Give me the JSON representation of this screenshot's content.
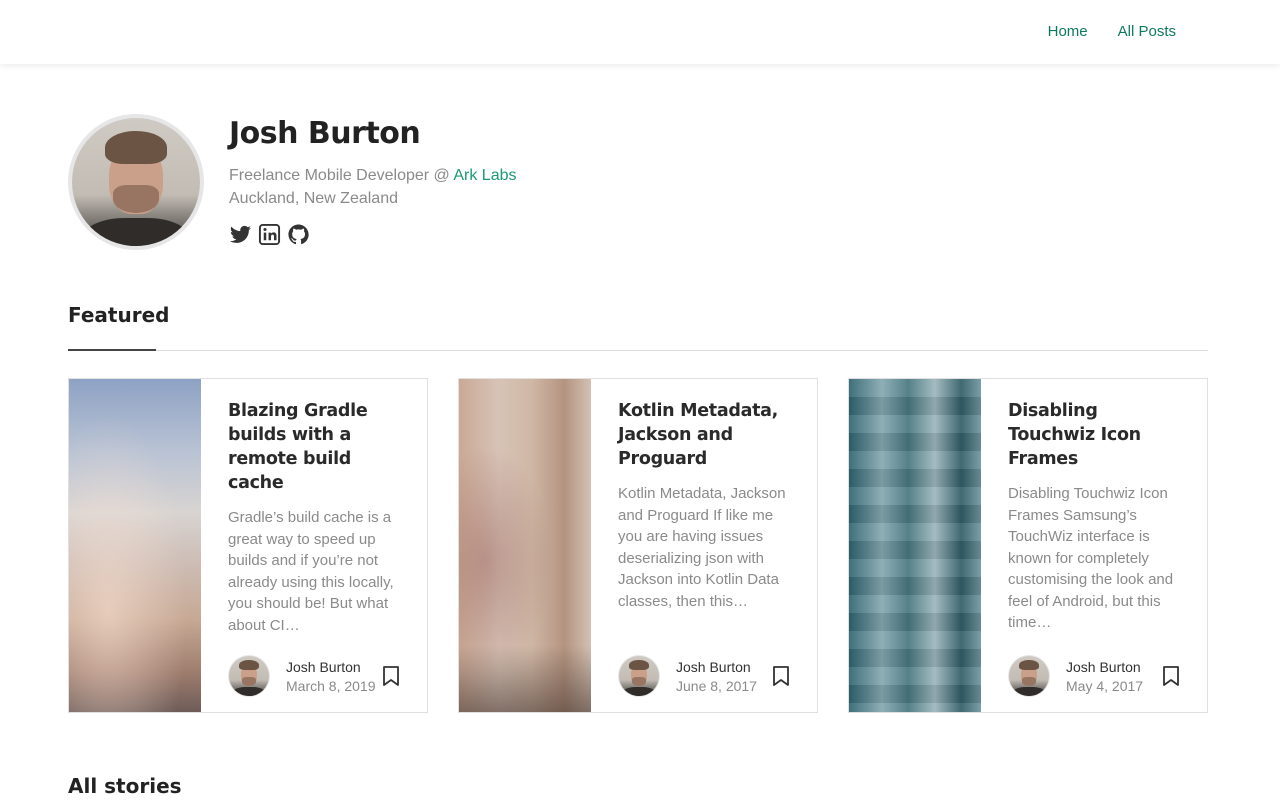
{
  "nav": {
    "items": [
      "Home",
      "All Posts"
    ]
  },
  "profile": {
    "name": "Josh Burton",
    "bio_prefix": "Freelance Mobile Developer @ ",
    "company": "Ark Labs",
    "location": "Auckland, New Zealand",
    "socials": [
      "twitter-icon",
      "linkedin-icon",
      "github-icon"
    ]
  },
  "featured": {
    "heading": "Featured",
    "cards": [
      {
        "title": "Blazing Gradle builds with a remote build cache",
        "excerpt": "Gradle’s build cache is a great way to speed up builds and if you’re not already using this locally, you should be! But what about CI…",
        "author": "Josh Burton",
        "date": "March 8, 2019"
      },
      {
        "title": "Kotlin Metadata, Jackson and Proguard",
        "excerpt": "Kotlin Metadata, Jackson and Proguard If like me you are having issues deserializing json with Jackson into Kotlin Data classes, then this…",
        "author": "Josh Burton",
        "date": "June 8, 2017"
      },
      {
        "title": "Disabling Touchwiz Icon Frames",
        "excerpt": "Disabling Touchwiz Icon Frames Samsung’s TouchWiz interface is known for completely customising the look and feel of Android, but this time…",
        "author": "Josh Burton",
        "date": "May 4, 2017"
      }
    ]
  },
  "all_stories": {
    "heading": "All stories"
  },
  "colors": {
    "accent": "#1a9a73",
    "nav_link": "#0d7a5f",
    "muted": "#8a8a8a"
  }
}
